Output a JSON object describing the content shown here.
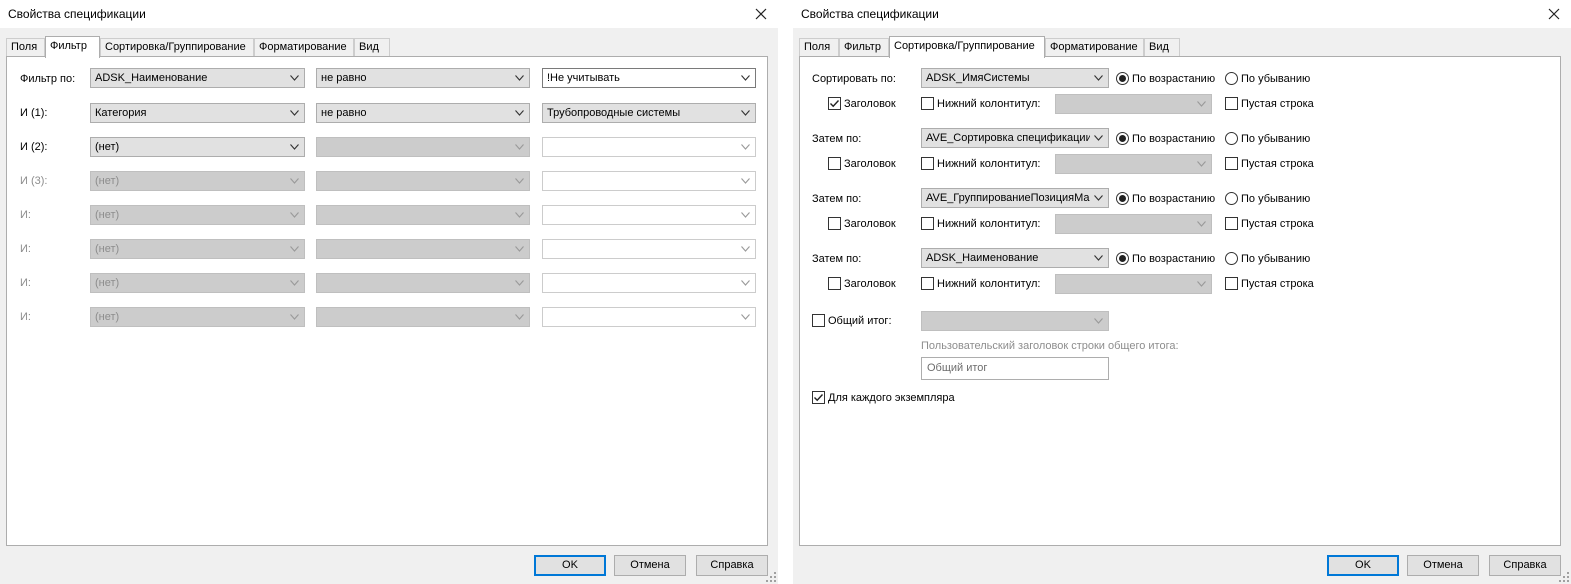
{
  "left": {
    "title": "Свойства спецификации",
    "tabs": [
      "Поля",
      "Фильтр",
      "Сортировка/Группирование",
      "Форматирование",
      "Вид"
    ],
    "active_tab": "Фильтр",
    "rows": [
      {
        "label": "Фильтр по:",
        "field": "ADSK_Наименование",
        "operator": "не равно",
        "value": "!Не учитывать"
      },
      {
        "label": "И (1):",
        "field": "Категория",
        "operator": "не равно",
        "value": "Трубопроводные системы"
      },
      {
        "label": "И (2):",
        "field": "(нет)",
        "operator": "",
        "value": ""
      },
      {
        "label": "И (3):",
        "field": "(нет)",
        "operator": "",
        "value": ""
      },
      {
        "label": "И:",
        "field": "(нет)",
        "operator": "",
        "value": ""
      },
      {
        "label": "И:",
        "field": "(нет)",
        "operator": "",
        "value": ""
      },
      {
        "label": "И:",
        "field": "(нет)",
        "operator": "",
        "value": ""
      },
      {
        "label": "И:",
        "field": "(нет)",
        "operator": "",
        "value": ""
      }
    ],
    "buttons": {
      "ok": "OK",
      "cancel": "Отмена",
      "help": "Справка"
    }
  },
  "right": {
    "title": "Свойства спецификации",
    "tabs": [
      "Поля",
      "Фильтр",
      "Сортировка/Группирование",
      "Форматирование",
      "Вид"
    ],
    "active_tab": "Сортировка/Группирование",
    "sort_groups": [
      {
        "label": "Сортировать по:",
        "field": "ADSK_ИмяСистемы",
        "ascending": true,
        "header": true,
        "footer": false,
        "blank_line": false
      },
      {
        "label": "Затем по:",
        "field": "AVE_Сортировка спецификации",
        "ascending": true,
        "header": false,
        "footer": false,
        "blank_line": false
      },
      {
        "label": "Затем по:",
        "field": "AVE_ГруппированиеПозицияМар",
        "ascending": true,
        "header": false,
        "footer": false,
        "blank_line": false
      },
      {
        "label": "Затем по:",
        "field": "ADSK_Наименование",
        "ascending": true,
        "header": false,
        "footer": false,
        "blank_line": false
      }
    ],
    "labels": {
      "ascending": "По возрастанию",
      "descending": "По убыванию",
      "header": "Заголовок",
      "footer": "Нижний колонтитул:",
      "blank_line": "Пустая строка",
      "grand_total": "Общий итог:",
      "custom_total_title": "Пользовательский заголовок строки общего итога:",
      "every_instance": "Для каждого экземпляра"
    },
    "grand_total_checked": false,
    "grand_total_text": "Общий итог",
    "every_instance_checked": true,
    "buttons": {
      "ok": "OK",
      "cancel": "Отмена",
      "help": "Справка"
    }
  },
  "colors": {
    "accent": "#0078d7",
    "panel": "#ffffff",
    "chrome": "#f0f0f0"
  }
}
